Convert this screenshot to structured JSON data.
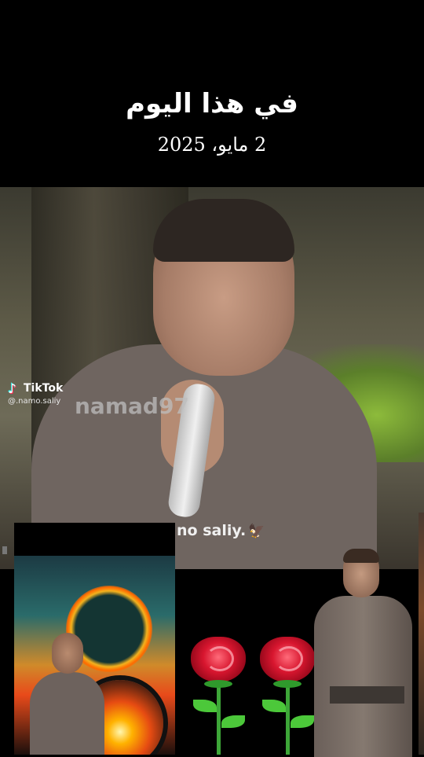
{
  "header": {
    "title": "في هذا اليوم",
    "date": "2 مايو، 2025"
  },
  "video": {
    "watermark": "namad97",
    "caption": "no saliy.",
    "caption_icon": "eagle-icon"
  },
  "tiktok": {
    "brand": "TikTok",
    "handle": "@.namo.saliy"
  },
  "colors": {
    "background": "#000000",
    "rose": "#d8162f",
    "stem": "#3da638"
  }
}
